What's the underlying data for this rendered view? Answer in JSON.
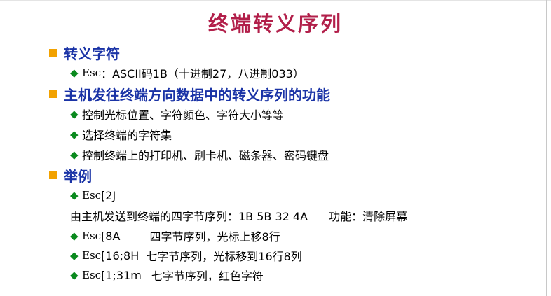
{
  "title": "终端转义序列",
  "section1": {
    "heading": "转义字符",
    "line1": {
      "esc": "Esc",
      "rest": "：ASCII码1B（十进制27，八进制033）"
    }
  },
  "section2": {
    "heading": "主机发往终端方向数据中的转义序列的功能",
    "items": [
      "控制光标位置、字符颜色、字符大小等等",
      "选择终端的字符集",
      "控制终端上的打印机、刷卡机、磁条器、密码键盘"
    ]
  },
  "section3": {
    "heading": "举例",
    "ex1": {
      "esc": "Esc",
      "seq": "[2J"
    },
    "ex1_desc": {
      "text": "由主机发送到终端的四字节序列：1B 5B 32 4A",
      "func": "功能：清除屏幕"
    },
    "ex2": {
      "esc": "Esc",
      "seq": "[8A",
      "desc": "四字节序列，光标上移8行"
    },
    "ex3": {
      "esc": "Esc",
      "seq": "[16;8H",
      "desc": "七字节序列，光标移到16行8列"
    },
    "ex4": {
      "esc": "Esc",
      "seq": "[1;31m",
      "desc": "七字节序列，红色字符"
    }
  },
  "colors": {
    "title": "#b21f4a",
    "heading": "#1a33a6",
    "square_bullet": "#f2a200",
    "diamond_bullet": "#0a8a1e",
    "rule": "#1f9aa8"
  },
  "icons": {
    "level1": "orange-square-bullet-icon",
    "level2": "green-diamond-bullet-icon"
  }
}
